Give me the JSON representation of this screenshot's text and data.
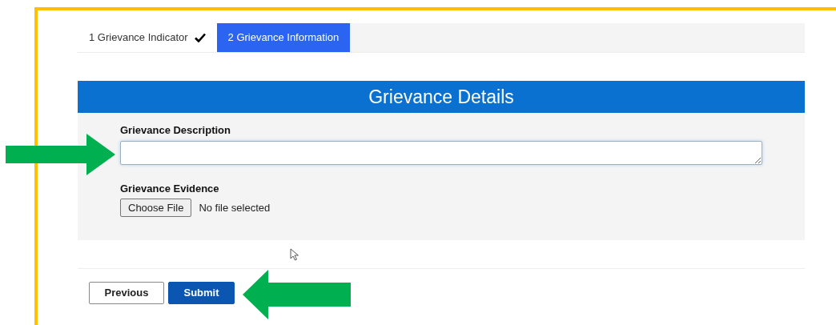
{
  "steps": [
    {
      "label": "1 Grievance Indicator",
      "selected": false,
      "completed": true
    },
    {
      "label": "2 Grievance Information",
      "selected": true,
      "completed": false
    }
  ],
  "section": {
    "title": "Grievance Details",
    "fields": [
      {
        "kind": "textarea",
        "label": "Grievance Description"
      },
      {
        "kind": "file",
        "label": "Grievance Evidence",
        "button": "Choose File",
        "status": "No file selected"
      }
    ]
  },
  "buttons": [
    {
      "label": "Previous",
      "kind": "secondary"
    },
    {
      "label": "Submit",
      "kind": "primary"
    }
  ]
}
